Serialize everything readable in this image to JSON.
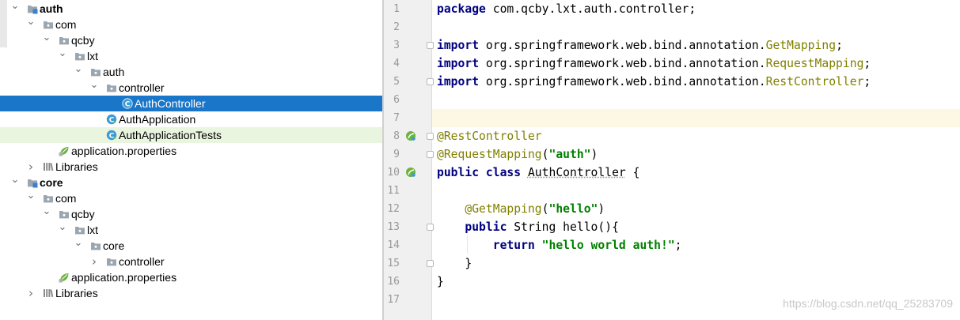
{
  "project_tree": {
    "rows": [
      {
        "label": "auth",
        "arrow": "expanded",
        "icon": "module-folder-icon",
        "bold": true
      },
      {
        "label": "com",
        "arrow": "expanded",
        "icon": "package-folder-icon"
      },
      {
        "label": "qcby",
        "arrow": "expanded",
        "icon": "package-folder-icon"
      },
      {
        "label": "lxt",
        "arrow": "expanded",
        "icon": "package-folder-icon"
      },
      {
        "label": "auth",
        "arrow": "expanded",
        "icon": "package-folder-icon"
      },
      {
        "label": "controller",
        "arrow": "expanded",
        "icon": "package-folder-icon"
      },
      {
        "label": "AuthController",
        "arrow": "none",
        "icon": "java-class-icon",
        "selected": true
      },
      {
        "label": "AuthApplication",
        "arrow": "none",
        "icon": "spring-class-icon"
      },
      {
        "label": "AuthApplicationTests",
        "arrow": "none",
        "icon": "spring-class-icon",
        "highlighted": true
      },
      {
        "label": "application.properties",
        "arrow": "none",
        "icon": "spring-properties-icon"
      },
      {
        "label": "Libraries",
        "arrow": "collapsed",
        "icon": "libraries-icon"
      },
      {
        "label": "core",
        "arrow": "expanded",
        "icon": "module-folder-icon",
        "bold": true
      },
      {
        "label": "com",
        "arrow": "expanded",
        "icon": "package-folder-icon"
      },
      {
        "label": "qcby",
        "arrow": "expanded",
        "icon": "package-folder-icon"
      },
      {
        "label": "lxt",
        "arrow": "expanded",
        "icon": "package-folder-icon"
      },
      {
        "label": "core",
        "arrow": "expanded",
        "icon": "package-folder-icon"
      },
      {
        "label": "controller",
        "arrow": "collapsed",
        "icon": "package-folder-icon"
      },
      {
        "label": "application.properties",
        "arrow": "none",
        "icon": "spring-properties-icon"
      },
      {
        "label": "Libraries",
        "arrow": "collapsed",
        "icon": "libraries-icon"
      }
    ]
  },
  "editor": {
    "line_numbers": [
      "1",
      "2",
      "3",
      "4",
      "5",
      "6",
      "7",
      "8",
      "9",
      "10",
      "11",
      "12",
      "13",
      "14",
      "15",
      "16",
      "17"
    ],
    "caret_line": 7,
    "gutter_icons": [
      {
        "line": 8,
        "icon": "spring-bean-icon"
      },
      {
        "line": 10,
        "icon": "spring-bean-icon"
      }
    ],
    "fold_markers": [
      3,
      5,
      8,
      9,
      13,
      15
    ],
    "lines": [
      [
        {
          "t": "package",
          "c": "kw"
        },
        {
          "t": " com.qcby.lxt.auth.controller;"
        }
      ],
      [],
      [
        {
          "t": "import",
          "c": "kw"
        },
        {
          "t": " org.springframework.web.bind.annotation."
        },
        {
          "t": "GetMapping",
          "c": "ref"
        },
        {
          "t": ";"
        }
      ],
      [
        {
          "t": "import",
          "c": "kw"
        },
        {
          "t": " org.springframework.web.bind.annotation."
        },
        {
          "t": "RequestMapping",
          "c": "ref"
        },
        {
          "t": ";"
        }
      ],
      [
        {
          "t": "import",
          "c": "kw"
        },
        {
          "t": " org.springframework.web.bind.annotation."
        },
        {
          "t": "RestController",
          "c": "ref"
        },
        {
          "t": ";"
        }
      ],
      [],
      [],
      [
        {
          "t": "@RestController",
          "c": "ann"
        }
      ],
      [
        {
          "t": "@RequestMapping",
          "c": "ann"
        },
        {
          "t": "("
        },
        {
          "t": "\"auth\"",
          "c": "str"
        },
        {
          "t": ")"
        }
      ],
      [
        {
          "t": "public",
          "c": "kw"
        },
        {
          "t": " "
        },
        {
          "t": "class",
          "c": "kw"
        },
        {
          "t": " "
        },
        {
          "t": "AuthController",
          "c": "ul"
        },
        {
          "t": " {"
        }
      ],
      [],
      [
        {
          "t": "    "
        },
        {
          "t": "@GetMapping",
          "c": "ann"
        },
        {
          "t": "("
        },
        {
          "t": "\"hello\"",
          "c": "str"
        },
        {
          "t": ")"
        }
      ],
      [
        {
          "t": "    "
        },
        {
          "t": "public",
          "c": "kw"
        },
        {
          "t": " String hello(){"
        }
      ],
      [
        {
          "t": "        "
        },
        {
          "t": "return",
          "c": "kw"
        },
        {
          "t": " "
        },
        {
          "t": "\"hello world auth!\"",
          "c": "str"
        },
        {
          "t": ";"
        }
      ],
      [
        {
          "t": "    }"
        }
      ],
      [
        {
          "t": "}"
        }
      ],
      []
    ]
  },
  "watermark": "https://blog.csdn.net/qq_25283709",
  "colors": {
    "selection": "#1976c9",
    "keyword": "#000080",
    "annotation": "#808000",
    "string": "#008000",
    "caret_line": "#fcf8e4"
  }
}
